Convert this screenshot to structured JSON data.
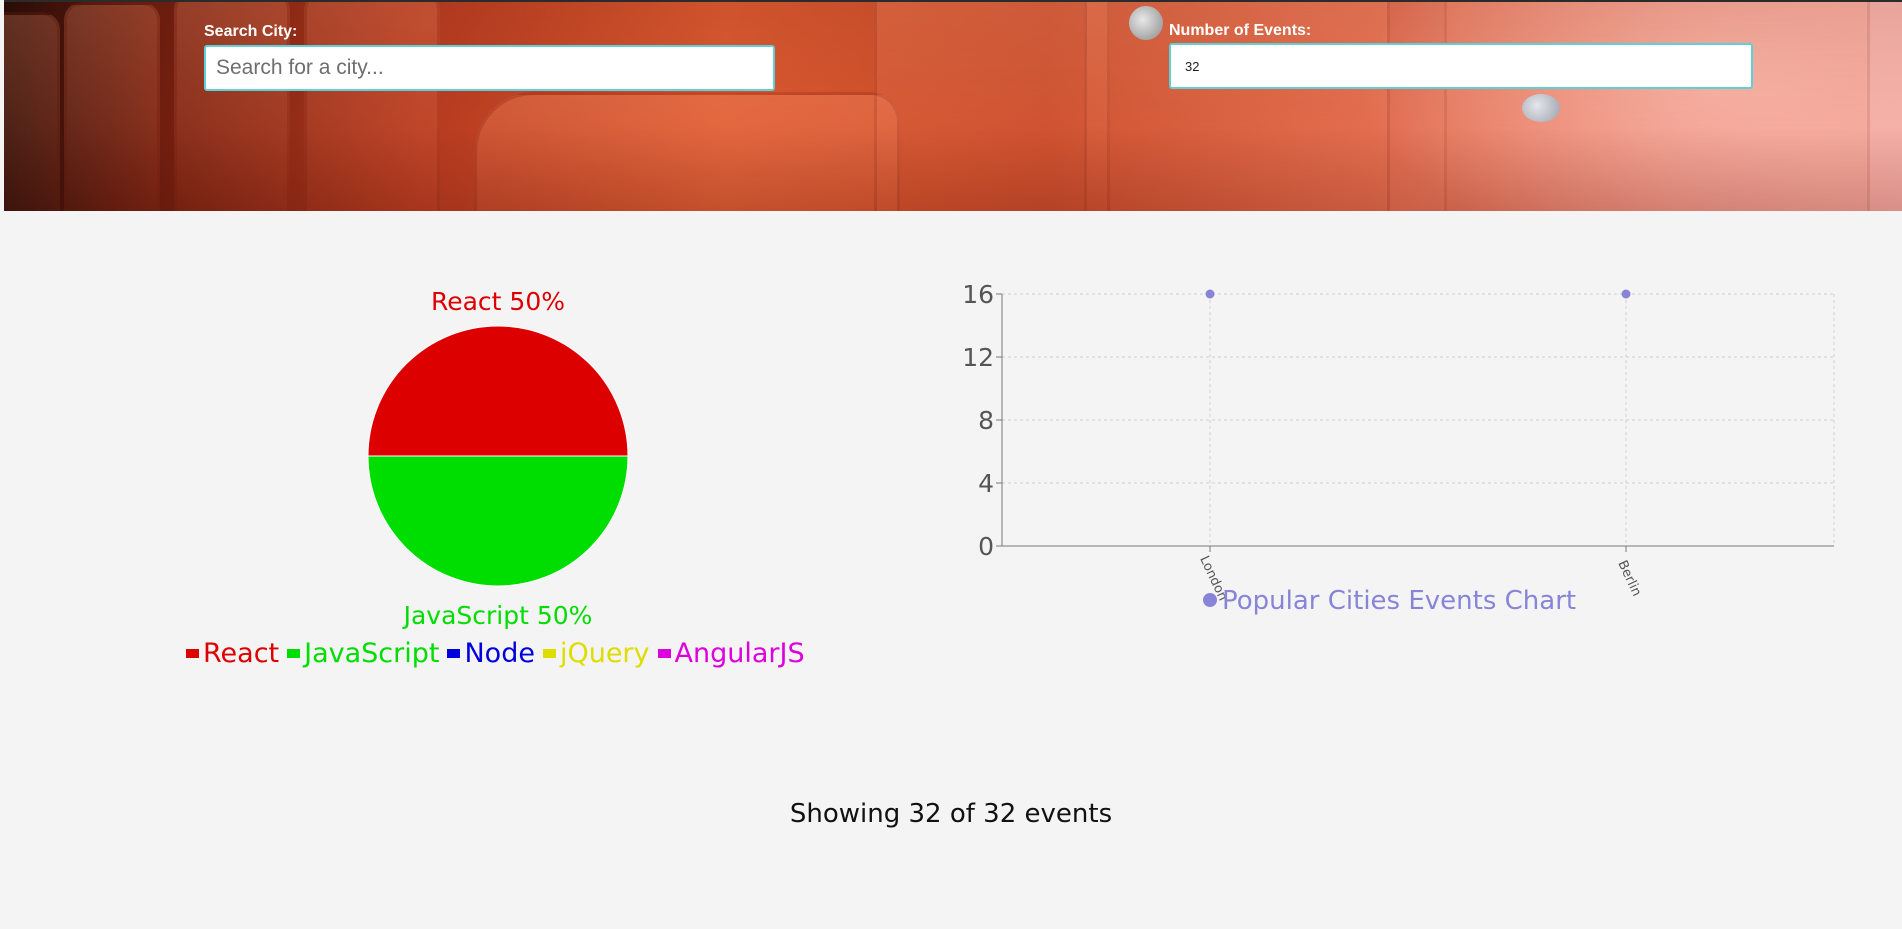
{
  "search": {
    "city_label": "Search City:",
    "city_placeholder": "Search for a city...",
    "city_value": "",
    "events_label": "Number of Events:",
    "events_value": "32"
  },
  "chart_data": [
    {
      "type": "pie",
      "categories": [
        "React",
        "JavaScript"
      ],
      "values": [
        50,
        50
      ],
      "slice_labels": [
        "React 50%",
        "JavaScript 50%"
      ],
      "colors": [
        "#dd0000",
        "#00dd00"
      ],
      "legend": [
        {
          "label": "React",
          "color": "#dd0000"
        },
        {
          "label": "JavaScript",
          "color": "#00dd00"
        },
        {
          "label": "Node",
          "color": "#0000dd"
        },
        {
          "label": "jQuery",
          "color": "#dddd00"
        },
        {
          "label": "AngularJS",
          "color": "#dd00dd"
        }
      ],
      "legend_position": "bottom"
    },
    {
      "type": "scatter",
      "categories": [
        "London",
        "Berlin"
      ],
      "series": [
        {
          "name": "Popular Cities Events Chart",
          "values": [
            16,
            16
          ],
          "color": "#8884d8"
        }
      ],
      "yticks": [
        0,
        4,
        8,
        12,
        16
      ],
      "ylim": [
        0,
        16
      ],
      "grid": true,
      "legend_position": "bottom"
    }
  ],
  "summary": {
    "text": "Showing 32 of 32 events"
  }
}
